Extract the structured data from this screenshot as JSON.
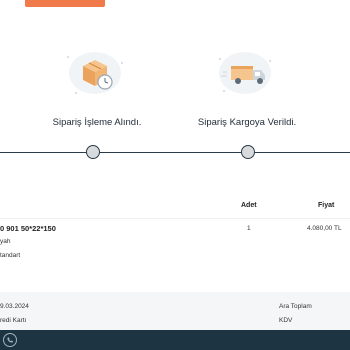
{
  "steps": [
    {
      "label": "Sipariş İşleme Alındı.",
      "icon": "package-clock-icon"
    },
    {
      "label": "Sipariş Kargoya Verildi.",
      "icon": "delivery-truck-icon"
    }
  ],
  "table": {
    "headers": {
      "quantity": "Adet",
      "price": "Fiyat"
    },
    "item": {
      "name": "0 901 50*22*150",
      "color": "yah",
      "variant": "tandart",
      "quantity": "1",
      "price": "4.080,00 TL"
    }
  },
  "footer": {
    "date": "9.03.2024",
    "payment": "redi Kartı",
    "subtotal_label": "Ara Toplam",
    "tax_label": "KDV"
  },
  "colors": {
    "accent": "#f07a4a",
    "timeline": "#2c3b48",
    "bottom_bar": "#1d3543"
  }
}
